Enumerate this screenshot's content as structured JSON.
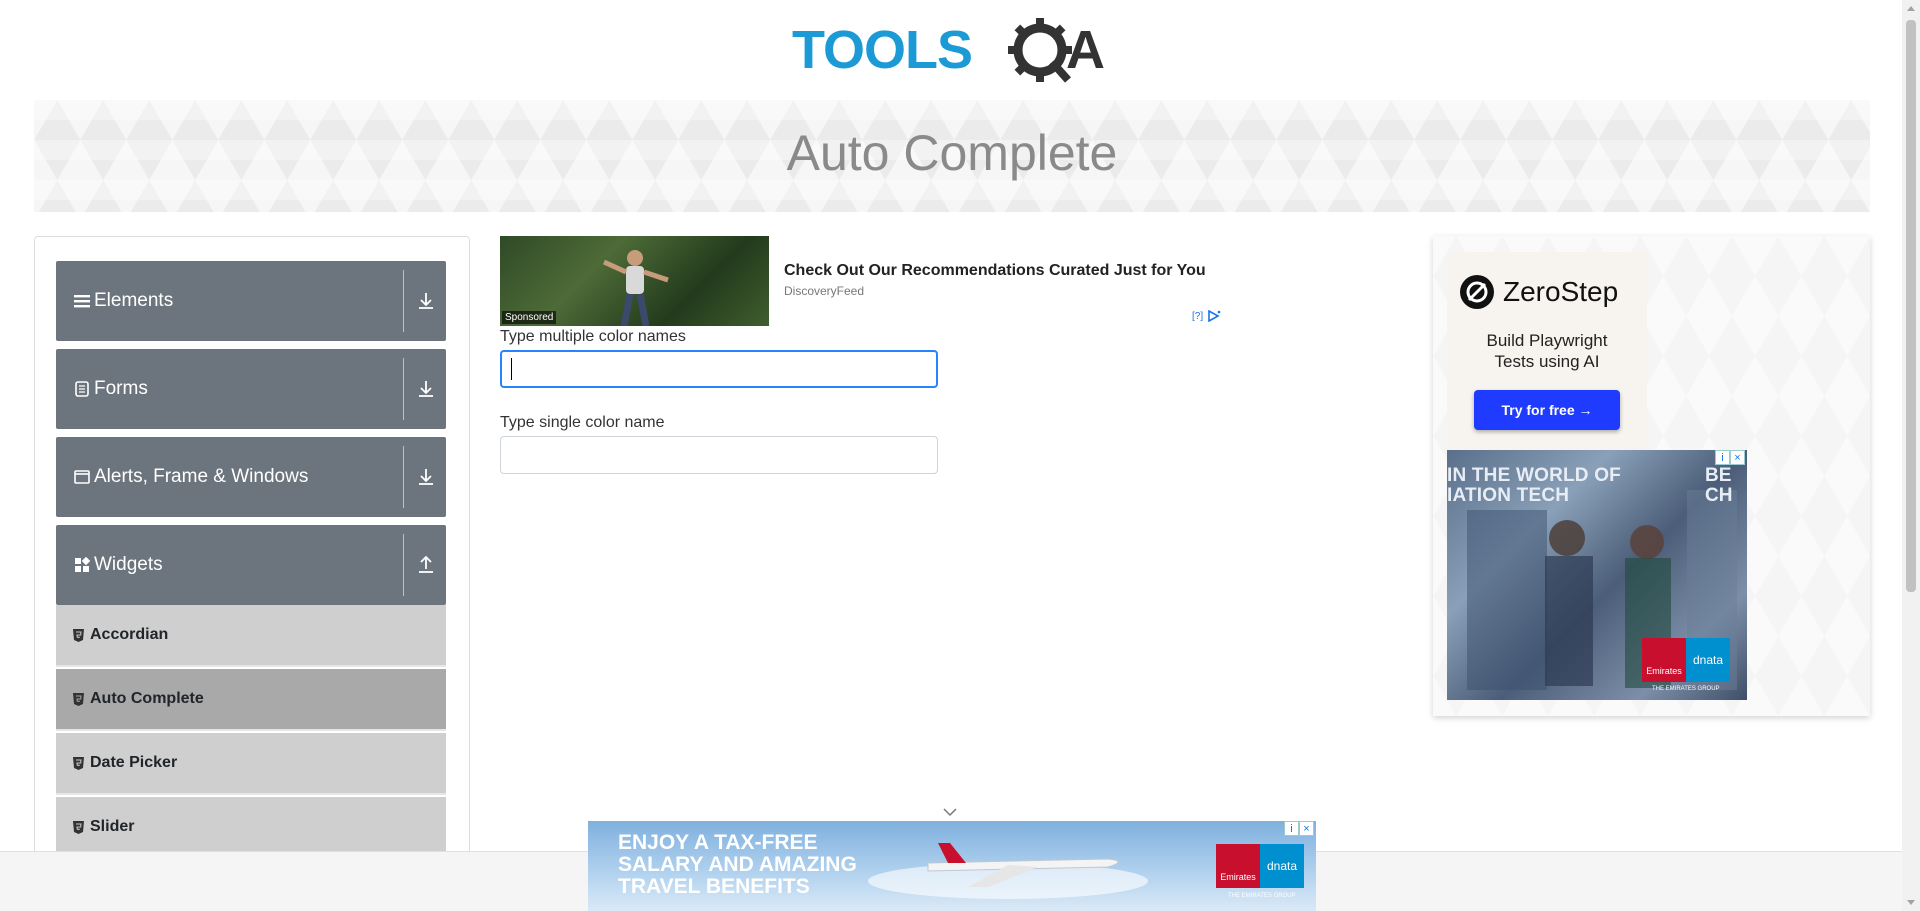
{
  "header": {
    "logo_text": "TOOLSQA",
    "logo_colors": {
      "blue": "#1b9ad6",
      "dark": "#333333"
    }
  },
  "banner": {
    "title": "Auto Complete"
  },
  "sidebar": {
    "groups": [
      {
        "title": "Elements",
        "icon": "bars-icon",
        "expanded": false
      },
      {
        "title": "Forms",
        "icon": "form-icon",
        "expanded": false
      },
      {
        "title": "Alerts, Frame & Windows",
        "icon": "window-icon",
        "expanded": false
      },
      {
        "title": "Widgets",
        "icon": "widgets-icon",
        "expanded": true
      }
    ],
    "widgets_items": [
      {
        "label": "Accordian",
        "active": false
      },
      {
        "label": "Auto Complete",
        "active": true
      },
      {
        "label": "Date Picker",
        "active": false
      },
      {
        "label": "Slider",
        "active": false
      }
    ]
  },
  "ad_top": {
    "sponsored": "Sponsored",
    "title": "Check Out Our Recommendations Curated Just for You",
    "source": "DiscoveryFeed",
    "choices": "[?]"
  },
  "form": {
    "multiple": {
      "label": "Type multiple color names",
      "value": ""
    },
    "single": {
      "label": "Type single color name",
      "value": ""
    }
  },
  "right_ad": {
    "brand": "ZeroStep",
    "tagline_line1": "Build Playwright",
    "tagline_line2": "Tests using AI",
    "cta": "Try for free →",
    "emirates": {
      "text_line1": "IN THE WORLD OF",
      "text_line2": "IATION TECH",
      "text_right1": "BE",
      "text_right2": "CH",
      "logo_left": "Emirates",
      "logo_right": "dnata",
      "group": "THE EMIRATES GROUP"
    }
  },
  "bottom_ad": {
    "line1": "ENJOY A TAX-FREE",
    "line2": "SALARY AND AMAZING",
    "line3": "TRAVEL BENEFITS",
    "logo_left": "Emirates",
    "logo_right": "dnata",
    "group": "THE EMIRATES GROUP"
  },
  "colors": {
    "sidebar_header": "#6c757d",
    "menu_item": "#cfcfcf",
    "menu_active": "#a9a9a9",
    "focus": "#2684ff",
    "cta": "#1f3bff"
  }
}
